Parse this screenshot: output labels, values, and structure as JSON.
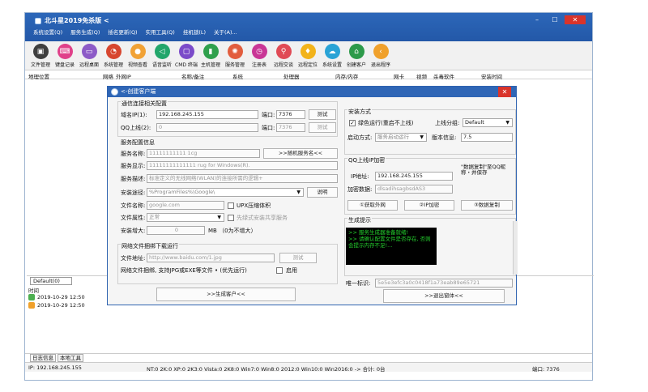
{
  "window": {
    "title": "北斗星2019免杀版  <",
    "menu": [
      "系统设置(Q)",
      "服务生成(Q)",
      "插名更新(Q)",
      "实用工具(Q)",
      "挂机锁(L)",
      "关于(A)..."
    ]
  },
  "toolbar": [
    {
      "label": "文件管理",
      "color": "#3f3f3f"
    },
    {
      "label": "键盘记录",
      "color": "#e0418a"
    },
    {
      "label": "远程桌面",
      "color": "#8d5bc7"
    },
    {
      "label": "系统管理",
      "color": "#d7462f"
    },
    {
      "label": "视频查看",
      "color": "#f1a236"
    },
    {
      "label": "语音监听",
      "color": "#22a66b"
    },
    {
      "label": "CMD 终端",
      "color": "#7b4bc9"
    },
    {
      "label": "主机管理",
      "color": "#2fa04c"
    },
    {
      "label": "服务管理",
      "color": "#e25d3e"
    },
    {
      "label": "注册表",
      "color": "#c93696"
    },
    {
      "label": "远程交谈",
      "color": "#e04a55"
    },
    {
      "label": "远程定位",
      "color": "#f2b31a"
    },
    {
      "label": "系统设置",
      "color": "#29a3d6"
    },
    {
      "label": "创建客户",
      "color": "#2d9a4a"
    },
    {
      "label": "退出程序",
      "color": "#f0a12c"
    }
  ],
  "columns": [
    "地理位置",
    "网络",
    "外网IP",
    "名称/备注",
    "系统",
    "处理器",
    "内存/内存",
    "网卡",
    "视频",
    "杀毒软件",
    "安装时间"
  ],
  "group_tab": "Default(0)",
  "log": {
    "header": "时间",
    "rows": [
      "2019-10-29 12:50",
      "2019-10-29 12:50"
    ]
  },
  "bottom_tabs": [
    "日志信息",
    "本地工具"
  ],
  "status": {
    "ip": "IP: 192.168.245.155",
    "stats": "NT:0  2K:0  XP:0  2K3:0  Vista:0  2K8:0  Win7:0  Win8:0  2012:0  Win10:0  Win2016:0  -> 合计: 0台",
    "port": "端口: 7376"
  },
  "dialog": {
    "title": "<-创建客户端",
    "conn_group": "通信连接相关配置",
    "domain1_label": "域名IP(1):",
    "domain1_value": "192.168.245.155",
    "port_label": "端口:",
    "port1_value": "7376",
    "test_label": "测试",
    "qq_label": "QQ上线(2):",
    "qq_value": "0",
    "port2_value": "7376",
    "service_group": "服务配置信息",
    "svc_name_label": "服务名称:",
    "svc_name_value": "11111111111 1cg",
    "random_btn": ">>随机服务名<<",
    "svc_display_label": "服务显示:",
    "svc_display_value": "11111111111111 rug for Windows(R).",
    "svc_desc_label": "服务描述:",
    "svc_desc_value": "标准定义的无线网络(WLAN)的连接所需的逻辑+",
    "install_path_label": "安装途径:",
    "install_path_value": "%ProgramFiles%\\Google\\",
    "explain_btn": "说明",
    "file_name_label": "文件名称:",
    "file_name_value": "google.com",
    "upx_label": "UPX压缩体积",
    "file_attr_label": "文件属性:",
    "file_attr_value": "正常",
    "green_install_label": "先绿式安装共享服务",
    "inflate_label": "安装增大:",
    "inflate_value": "0",
    "inflate_unit": "MB （0为不增大）",
    "net_file_group": "网络文件捆绑下载运行",
    "file_addr_label": "文件地址:",
    "file_addr_value": "http://www.baidu.com/1.jpg",
    "bind_desc": "网络文件捆绑, 支持JPG或EXE等文件 • (优先运行)",
    "enable_label": "启用",
    "gen_btn": ">>生成客户<<",
    "install_group": "安装方式",
    "green_run_label": "绿色运行(重启不上线)",
    "online_group_label": "上线分组:",
    "online_group_value": "Default",
    "start_mode_label": "启动方式:",
    "start_mode_value": "服务启动运行",
    "version_label": "版本信息:",
    "version_value": "7.5",
    "qq_ip_group": "QQ上线IP加密",
    "ip_addr_label": "IP地址:",
    "ip_addr_value": "192.168.245.155",
    "ip_note": "\"数据复制\"至QQ昵称・并保存",
    "encrypt_data_label": "加密数据:",
    "encrypt_data_value": "dlsadihsagbsdAS3",
    "get_ip_btn": "①获取外网",
    "ip_encrypt_btn": "②IP加密",
    "copy_btn": "③数据复制",
    "gen_hint_group": "生成提示",
    "console_lines": [
      ">> 服务生成器准备就绪!",
      ">> 请确认配置文件是否存在, 否则会提示内存不足!..."
    ],
    "unique_label": "唯一标识:",
    "unique_value": "5e5e3efc3a0c0418f1a73eab89e65721",
    "exit_btn": ">>退出窗体<<"
  }
}
